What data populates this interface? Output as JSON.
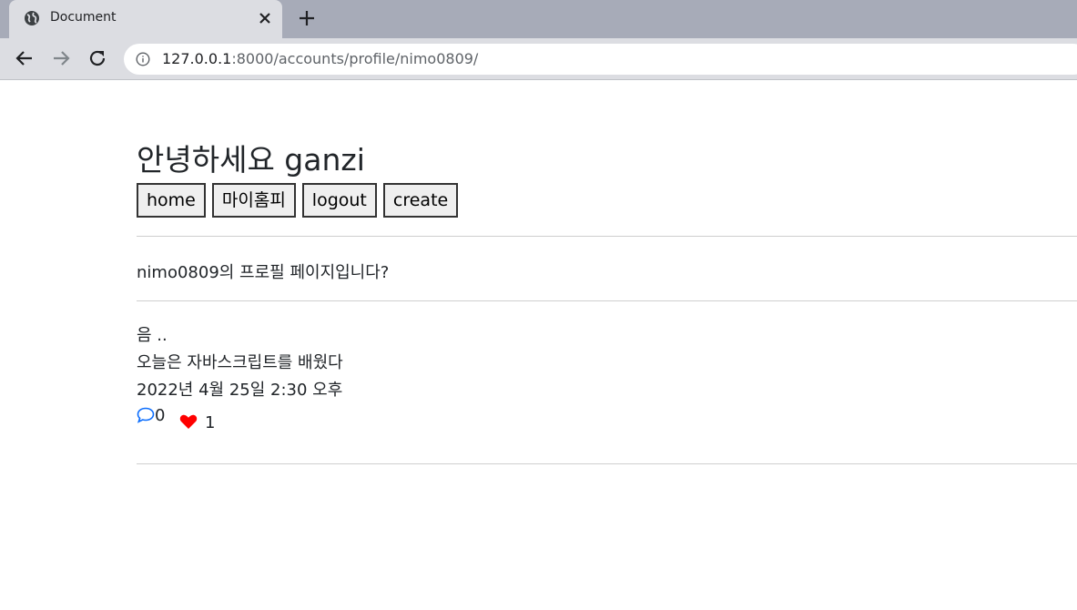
{
  "browser": {
    "tab_title": "Document",
    "url_host": "127.0.0.1",
    "url_path": ":8000/accounts/profile/nimo0809/"
  },
  "page": {
    "greeting": "안녕하세요 ganzi",
    "buttons": {
      "home": "home",
      "myhome": "마이홈피",
      "logout": "logout",
      "create": "create"
    },
    "profile_heading": "nimo0809의 프로필 페이지입니다?",
    "post": {
      "title": "음 ..",
      "content": "오늘은 자바스크립트를 배웠다",
      "date": "2022년 4월 25일 2:30 오후",
      "comment_count": "0",
      "like_count": "1"
    }
  },
  "colors": {
    "comment_icon": "#0d6efd",
    "heart_icon": "#ff0000"
  }
}
